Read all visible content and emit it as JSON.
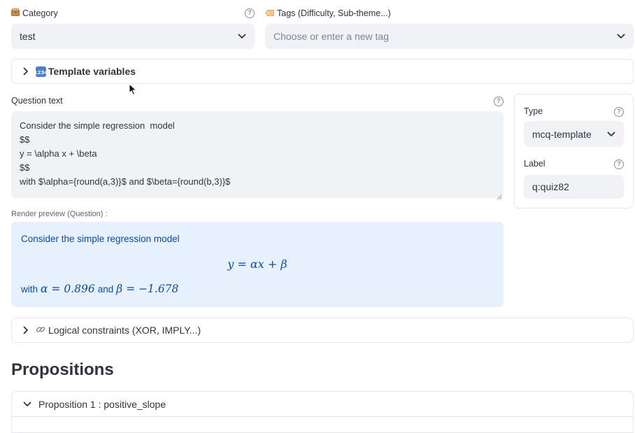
{
  "category": {
    "icon": "card-file-box-icon",
    "label": "Category",
    "value": "test"
  },
  "tags": {
    "icon": "label-icon",
    "label": "Tags (Difficulty, Sub-theme...)",
    "placeholder": "Choose or enter a new tag"
  },
  "template_variables": {
    "icon": "input-numbers-icon",
    "label": "Template variables",
    "emoji": "🔢"
  },
  "question": {
    "label": "Question text",
    "text": "Consider the simple regression  model\n$$\ny = \\alpha x + \\beta\n$$\nwith $\\alpha={round(a,3)}$ and $\\beta={round(b,3)}$"
  },
  "preview": {
    "label": "Render preview (Question) :",
    "line1": "Consider the simple regression model",
    "equation": "y = αx + β",
    "with_word": "with",
    "alpha_expr": "α = 0.896",
    "and_word": "and",
    "beta_expr": "β = −1.678"
  },
  "type_field": {
    "label": "Type",
    "value": "mcq-template"
  },
  "label_field": {
    "label": "Label",
    "value": "q:quiz82"
  },
  "constraints": {
    "icon": "link-icon",
    "label": "Logical constraints (XOR, IMPLY...)",
    "emoji": "🔗"
  },
  "propositions": {
    "heading": "Propositions",
    "items": [
      {
        "label": "Proposition 1 : positive_slope"
      }
    ]
  },
  "help_glyph": "?"
}
